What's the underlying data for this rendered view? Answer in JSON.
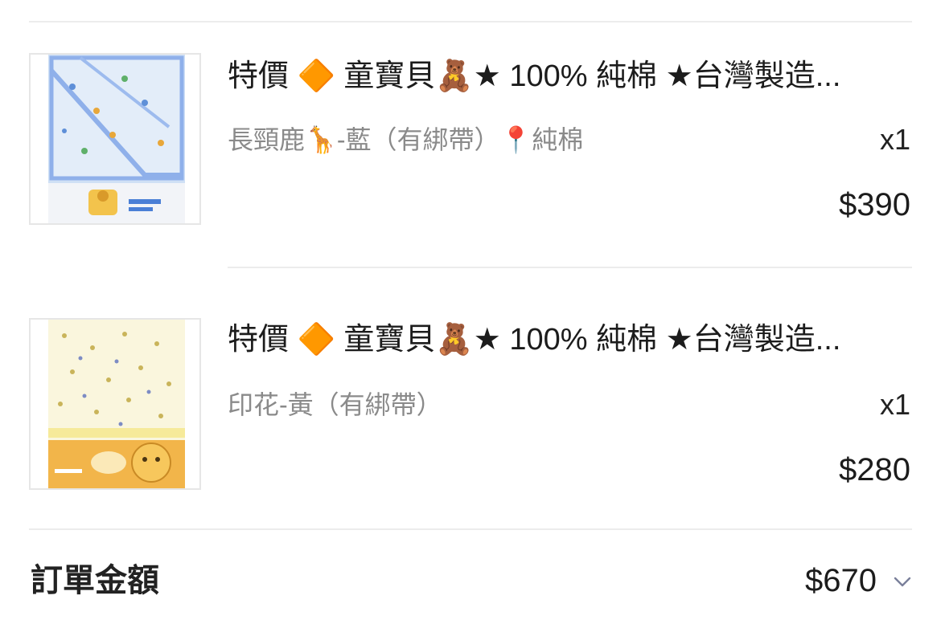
{
  "items": [
    {
      "title": "特價 🔶 童寶貝🧸★ 100% 純棉 ★台灣製造...",
      "variant": "長頸鹿🦒-藍（有綁帶）📍純棉",
      "quantity": "x1",
      "price": "$390",
      "thumbnail": "blue-giraffe-baby-blanket-image"
    },
    {
      "title": "特價 🔶 童寶貝🧸★ 100% 純棉 ★台灣製造...",
      "variant": "印花-黃（有綁帶）",
      "quantity": "x1",
      "price": "$280",
      "thumbnail": "yellow-bear-baby-blanket-image"
    }
  ],
  "summary": {
    "label": "訂單金額",
    "total": "$670",
    "expand_icon": "chevron-down-icon"
  },
  "colors": {
    "divider": "#ececec",
    "muted_text": "#8a8a8a",
    "chevron": "#7a7f9a"
  }
}
